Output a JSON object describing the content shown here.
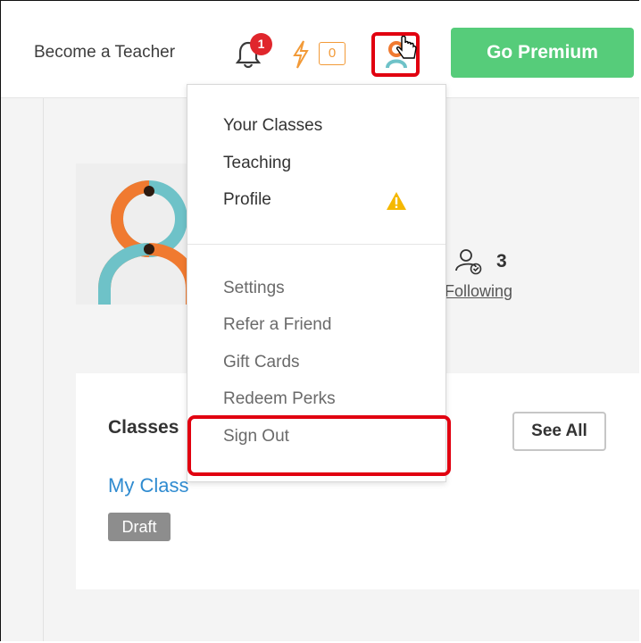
{
  "header": {
    "become_teacher": "Become a Teacher",
    "notifications_count": "1",
    "energy_count": "0",
    "premium_label": "Go Premium"
  },
  "menu": {
    "items_top": [
      "Your Classes",
      "Teaching",
      "Profile"
    ],
    "items_bottom": [
      "Settings",
      "Refer a Friend",
      "Gift Cards",
      "Redeem Perks",
      "Sign Out"
    ]
  },
  "profile": {
    "following_count": "3",
    "following_label": "Following"
  },
  "classes": {
    "title": "Classes",
    "see_all": "See All",
    "class_name": "My Class",
    "class_status": "Draft"
  },
  "colors": {
    "premium_green": "#56cc7a",
    "highlight_red": "#e10010",
    "link_blue": "#2f8bd0",
    "badge_red": "#e0262c",
    "energy_orange": "#f29a38",
    "warning_yellow": "#f5b800"
  },
  "icons": [
    "bell-icon",
    "bolt-icon",
    "user-avatar-icon",
    "hand-cursor-icon",
    "warning-icon",
    "following-user-icon"
  ]
}
